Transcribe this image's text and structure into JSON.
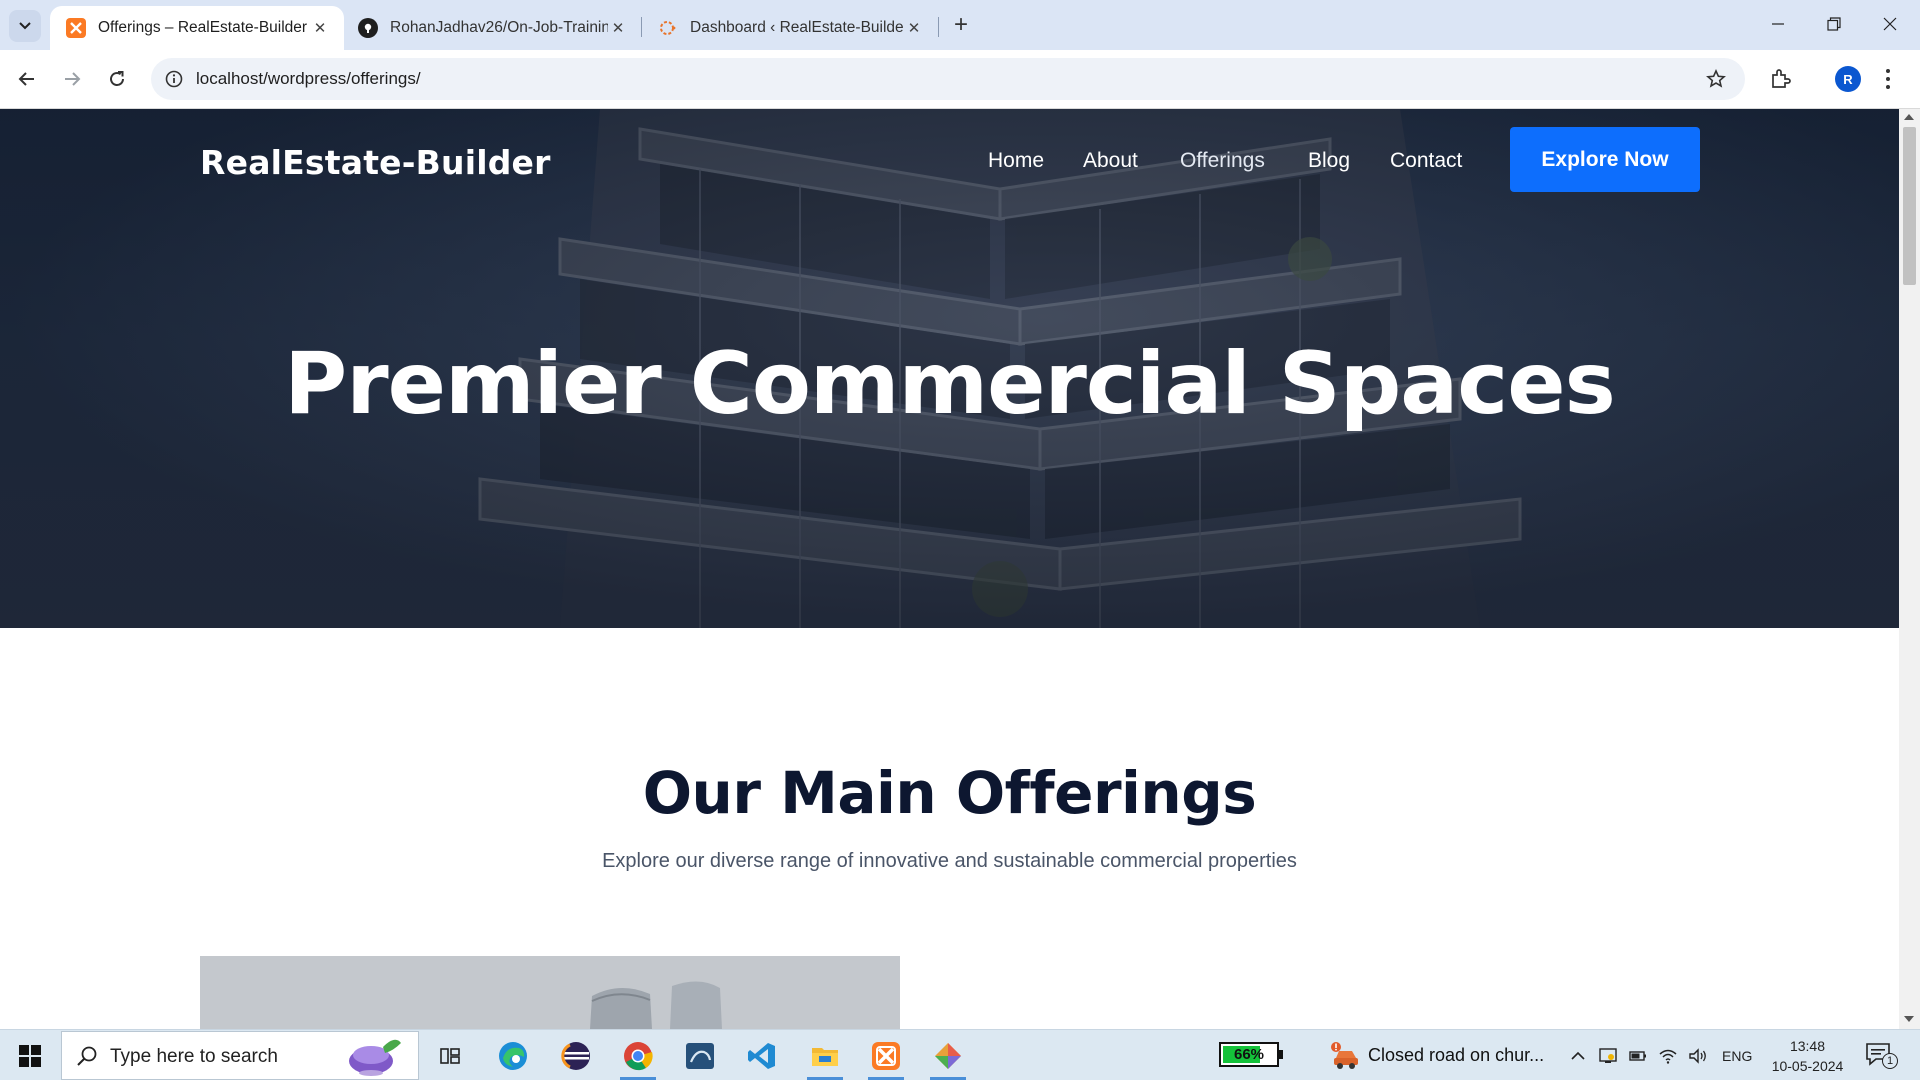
{
  "browser": {
    "tabs": [
      {
        "title": "Offerings – RealEstate-Builder",
        "icon": "xampp-favicon-icon",
        "active": true
      },
      {
        "title": "RohanJadhav26/On-Job-Trainin",
        "icon": "github-favicon-icon",
        "active": false
      },
      {
        "title": "Dashboard ‹ RealEstate-Builder",
        "icon": "wordpress-favicon-icon",
        "active": false
      }
    ],
    "url": "localhost/wordpress/offerings/",
    "profile_initial": "R"
  },
  "site": {
    "logo": "RealEstate-Builder",
    "nav": [
      {
        "label": "Home"
      },
      {
        "label": "About"
      },
      {
        "label": "Offerings",
        "current": true
      },
      {
        "label": "Blog"
      },
      {
        "label": "Contact"
      }
    ],
    "cta": "Explore Now",
    "hero_title": "Premier Commercial Spaces",
    "section_title": "Our Main Offerings",
    "section_subtitle": "Explore our diverse range of innovative and sustainable commercial properties",
    "accent_color": "#0d6efd",
    "heading_color": "#0d1730"
  },
  "taskbar": {
    "search_placeholder": "Type here to search",
    "battery_percent": "66%",
    "battery_level": 0.66,
    "news": "Closed road on chur...",
    "language": "ENG",
    "time": "13:48",
    "date": "10-05-2024",
    "notification_count": "1",
    "apps": [
      "windows-start-icon",
      "task-view-icon",
      "edge-icon",
      "eclipse-icon",
      "chrome-icon",
      "mysql-workbench-icon",
      "vscode-icon",
      "file-explorer-icon",
      "xampp-icon",
      "git-icon"
    ]
  }
}
